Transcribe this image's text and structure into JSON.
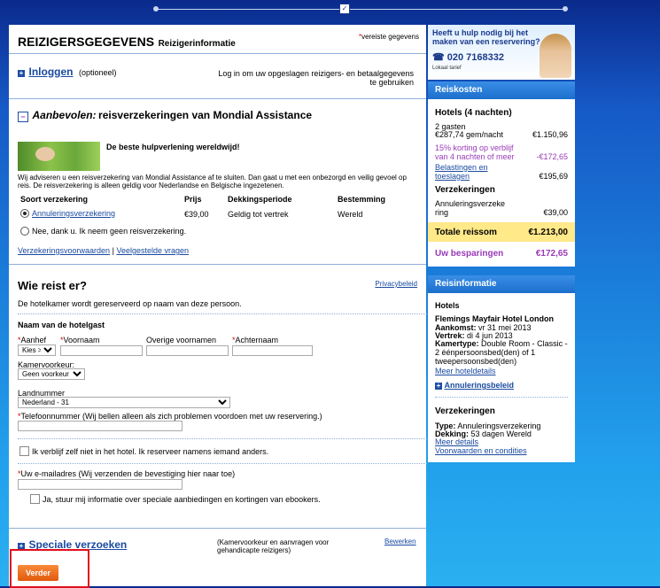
{
  "header": {
    "title": "REIZIGERSGEGEVENS",
    "subtitle": "Reizigerinformatie",
    "required_marker": "*",
    "required_note": "vereiste gegevens"
  },
  "login": {
    "link": "Inloggen",
    "optional": "(optioneel)",
    "note": "Log in om uw opgeslagen reizigers- en betaalgegevens te gebruiken"
  },
  "insurance": {
    "heading_em": "Aanbevolen:",
    "heading": "reisverzekeringen van Mondial Assistance",
    "tagline": "De beste hulpverlening wereldwijd!",
    "desc": "Wij adviseren u een reisverzekering van Mondial Assistance af te sluiten. Dan gaat u met een onbezorgd en veilig gevoel op reis. De reisverzekering is alleen geldig voor Nederlandse en Belgische ingezetenen.",
    "col_type": "Soort verzekering",
    "col_price": "Prijs",
    "col_period": "Dekkingsperiode",
    "col_dest": "Bestemming",
    "option_name": "Annuleringsverzekering",
    "option_price": "€39,00",
    "option_period": "Geldig tot vertrek",
    "option_dest": "Wereld",
    "decline": "Nee, dank u. Ik neem geen reisverzekering.",
    "link_terms": "Verzekeringsvoorwaarden",
    "sep": "|",
    "link_faq": "Veelgestelde vragen"
  },
  "travelers": {
    "heading": "Wie reist er?",
    "privacy": "Privacybeleid",
    "note": "De hotelkamer wordt gereserveerd op naam van deze persoon.",
    "guest_title": "Naam van de hotelgast",
    "aanhef_label": "Aanhef",
    "aanhef_value": "Kies >",
    "first_label": "Voornaam",
    "middle_label": "Overige voornamen",
    "last_label": "Achternaam",
    "room_label": "Kamervoorkeur:",
    "room_value": "Geen voorkeur",
    "country_label": "Landnummer",
    "country_value": "Nederland - 31",
    "phone_label": "Telefoonnummer (Wij bellen alleen als zich problemen voordoen met uw reservering.)",
    "not_staying": "Ik verblijf zelf niet in het hotel. Ik reserveer namens iemand anders.",
    "email_label": "Uw e-mailadres (Wij verzenden de bevestiging hier naar toe)",
    "newsletter": "Ja, stuur mij informatie over speciale aanbiedingen en kortingen van ebookers."
  },
  "special": {
    "link": "Speciale verzoeken",
    "note": "(Kamervoorkeur en aanvragen voor gehandicapte reizigers)",
    "edit": "Bewerken"
  },
  "submit": {
    "label": "Verder"
  },
  "help": {
    "text": "Heeft u hulp nodig bij het maken van een reservering?",
    "phone": "020 7168332",
    "rate": "Lokaal tarief"
  },
  "costs": {
    "heading": "Reiskosten",
    "hotels_title": "Hotels (4 nachten)",
    "guests": "2 gasten",
    "per_night": "€287,74 gem/nacht",
    "hotel_price": "€1.150,96",
    "discount": "15% korting op verblijf van 4 nachten of meer",
    "discount_price": "-€172,65",
    "taxes": "Belastingen en toeslagen",
    "taxes_price": "€195,69",
    "ins_title": "Verzekeringen",
    "ins_name": "Annuleringsverzekering",
    "ins_price": "€39,00",
    "total_label": "Totale reissom",
    "total": "€1.213,00",
    "savings_label": "Uw besparingen",
    "savings": "€172,65"
  },
  "info": {
    "heading": "Reisinformatie",
    "hotels_title": "Hotels",
    "hotel_name": "Flemings Mayfair Hotel London",
    "arrive_label": "Aankomst:",
    "arrive": "vr 31 mei 2013",
    "depart_label": "Vertrek:",
    "depart": "di 4 jun 2013",
    "room_label": "Kamertype:",
    "room": "Double Room - Classic - 2 éénpersoonsbed(den) of 1 tweepersoonsbed(den)",
    "details_link": "Meer hoteldetails",
    "cancel_link": "Annuleringsbeleid",
    "ins_title": "Verzekeringen",
    "type_label": "Type:",
    "type": "Annuleringsverzekering",
    "cover_label": "Dekking:",
    "cover": "53 dagen Wereld",
    "more": "Meer details",
    "terms": "Voorwaarden en condities"
  }
}
